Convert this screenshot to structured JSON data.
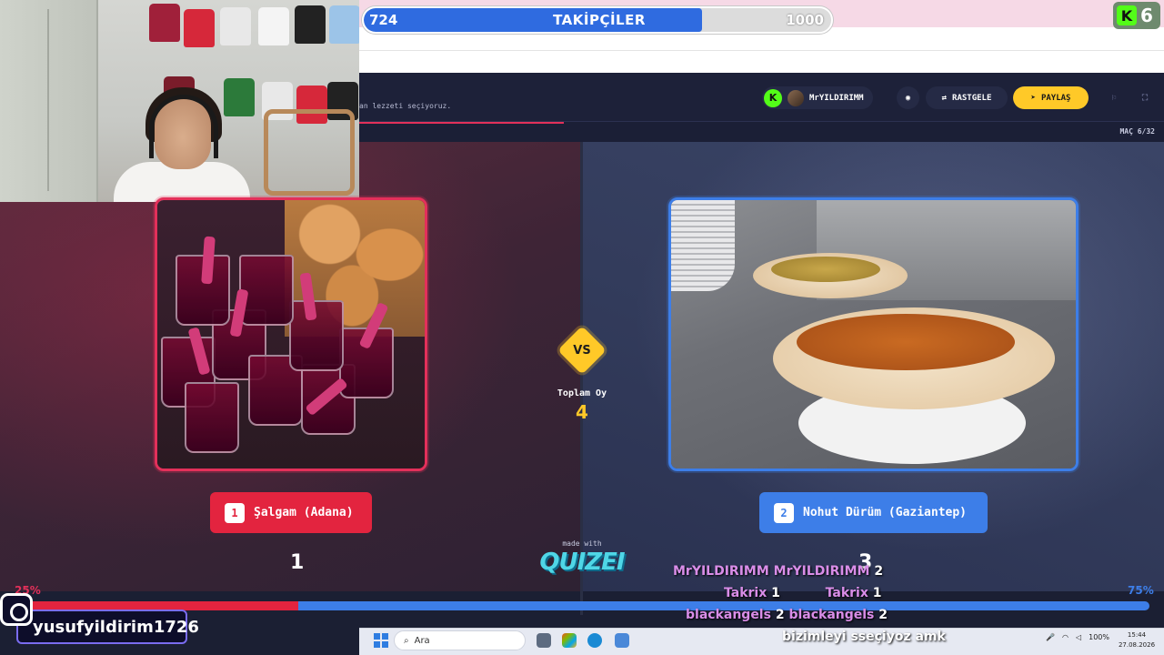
{
  "follower_goal": {
    "current": "724",
    "title": "TAKİPÇİLER",
    "goal": "1000",
    "progress_fraction": 0.724
  },
  "kick_counter": {
    "logo": "K",
    "count": "6"
  },
  "header": {
    "subtitle": "an lezzeti seçiyoruz.",
    "user_badge": "K",
    "username": "MrYILDIRIMM",
    "random_label": "RASTGELE",
    "share_label": "PAYLAŞ",
    "round_label": "MAÇ 6/32"
  },
  "icons": {
    "star": "☆",
    "eye": "◉",
    "random": "⇄",
    "share": "➤",
    "flag": "⚐",
    "fullscreen": "⛶",
    "extensions": "≡",
    "menu": "⋮",
    "search": "⌕",
    "mic": "🎤"
  },
  "matchup": {
    "left": {
      "number": "1",
      "name": "Şalgam (Adana)",
      "votes": "1",
      "percent": "25%",
      "fraction": 0.25,
      "color": "#e3243f"
    },
    "right": {
      "number": "2",
      "name": "Nohut Dürüm (Gaziantep)",
      "votes": "3",
      "percent": "75%",
      "fraction": 0.75,
      "color": "#3d7ee8"
    },
    "vs": "VS",
    "total_label": "Toplam Oy",
    "total_value": "4"
  },
  "branding": {
    "made_with": "made with",
    "logo": "QUIZEI"
  },
  "instagram": {
    "handle": "yusufyildirim1726"
  },
  "chat": [
    {
      "left_name": "MrYILDIRIMM",
      "right_name": "MrYILDIRIMM",
      "count": "2"
    },
    {
      "left_name": "Takrix",
      "left_count": "1",
      "right_name": "Takrix",
      "count": "1"
    },
    {
      "left_name": "blackangels",
      "left_count": "2",
      "right_name": "blackangels",
      "count": "2"
    },
    {
      "message": "bizimleyi sseçiyoz amk"
    }
  ],
  "taskbar": {
    "search_placeholder": "Ara",
    "battery": "100%",
    "time": "15:44",
    "date": "27.08.2026"
  },
  "colors": {
    "accent_red": "#e3243f",
    "accent_blue": "#3d7ee8",
    "accent_yellow": "#ffc928",
    "kick_green": "#53fc18"
  }
}
